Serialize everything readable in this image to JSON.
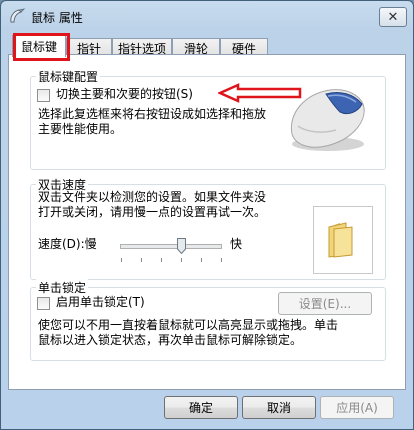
{
  "window": {
    "title": "鼠标 属性",
    "close_symbol": "✕"
  },
  "tabs": [
    {
      "label": "鼠标键",
      "active": true
    },
    {
      "label": "指针"
    },
    {
      "label": "指针选项"
    },
    {
      "label": "滑轮"
    },
    {
      "label": "硬件"
    }
  ],
  "button_config": {
    "group_label": "鼠标键配置",
    "checkbox_label": "切换主要和次要的按钮(S)",
    "checked": false,
    "description_lines": [
      "选择此复选框来将右按钮设成如选择和拖放",
      "主要性能使用。"
    ]
  },
  "double_click": {
    "group_label": "双击速度",
    "description_lines": [
      "双击文件夹以检测您的设置。如果文件夹没",
      "打开或关闭，请用慢一点的设置再试一次。"
    ],
    "speed_label": "速度(D):慢",
    "fast_label": "快",
    "speed_level_fraction": 0.6
  },
  "click_lock": {
    "group_label": "单击锁定",
    "checkbox_label": "启用单击锁定(T)",
    "checked": false,
    "settings_button": "设置(E)...",
    "description_lines": [
      "使您可以不用一直按着鼠标就可以高亮显示或拖拽。单击",
      "鼠标以进入锁定状态，再次单击鼠标可解除锁定。"
    ]
  },
  "footer": {
    "ok": "确定",
    "cancel": "取消",
    "apply": "应用(A)"
  },
  "colors": {
    "annotation_red": "#e0141b",
    "titlebar": "#c8dcee"
  },
  "icons": [
    "mouse-properties-icon",
    "mouse-image",
    "folder-icon",
    "red-arrow-annotation"
  ]
}
